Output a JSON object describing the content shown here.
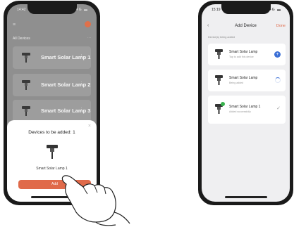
{
  "left_phone": {
    "status_time": "14:42",
    "status_icons": "..ll 4G ▬",
    "menu_icon": "menu-icon",
    "section_title": "All Devices",
    "section_more": "···",
    "devices": [
      {
        "name": "Smart Solar Lamp 1"
      },
      {
        "name": "Smart Solar Lamp 2"
      },
      {
        "name": "Smart Solar Lamp 3"
      }
    ],
    "sheet": {
      "close": "×",
      "title": "Devices to be added: 1",
      "device_name": "Smart Solar Lamp 1",
      "add_label": "Add"
    }
  },
  "right_phone": {
    "status_time": "15:19",
    "status_icons": "..ll 4G ▬",
    "nav": {
      "back": "‹",
      "title": "Add Device",
      "done": "Done"
    },
    "hint": "Device(s) being added",
    "devices": [
      {
        "name": "Smart Solar Lamp",
        "status": "Tap to add this device",
        "action": "plus"
      },
      {
        "name": "Smart Solar Lamp",
        "status": "Being added",
        "action": "spinner"
      },
      {
        "name": "Smart Solar Lamp 1",
        "status": "Added successfully",
        "action": "check"
      }
    ]
  },
  "colors": {
    "accent": "#e06a4a",
    "blue": "#3b6fd6",
    "success": "#37b24d"
  }
}
